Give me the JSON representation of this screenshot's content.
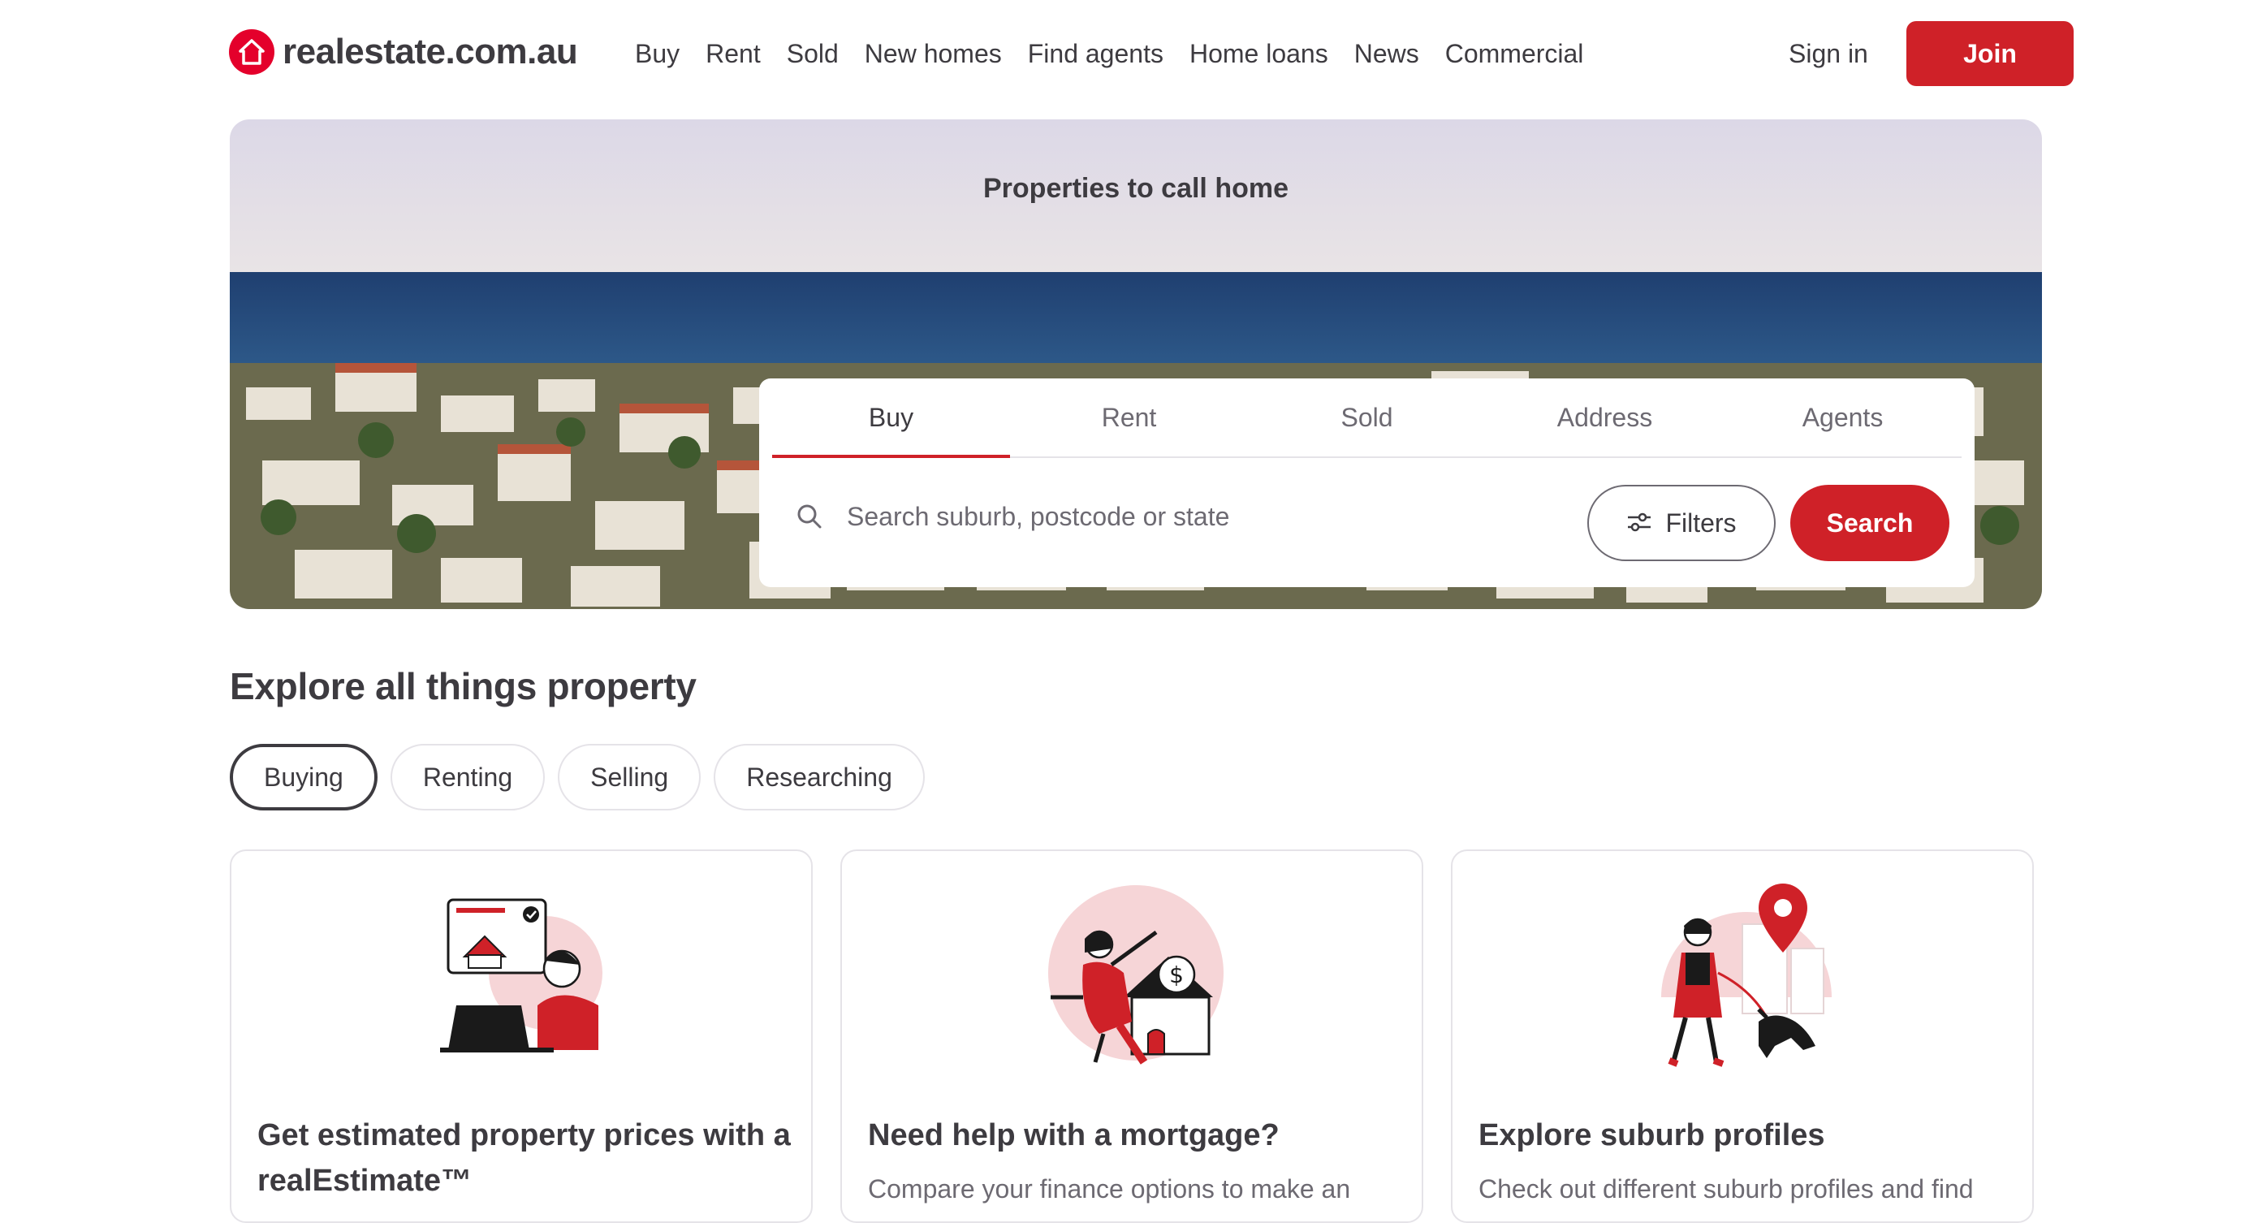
{
  "header": {
    "logo_text": "realestate.com.au",
    "nav": [
      "Buy",
      "Rent",
      "Sold",
      "New homes",
      "Find agents",
      "Home loans",
      "News",
      "Commercial"
    ],
    "signin_label": "Sign in",
    "join_label": "Join"
  },
  "hero": {
    "title": "Properties to call home",
    "tabs": [
      "Buy",
      "Rent",
      "Sold",
      "Address",
      "Agents"
    ],
    "active_tab": "Buy",
    "search_placeholder": "Search suburb, postcode or state",
    "filters_label": "Filters",
    "search_label": "Search"
  },
  "explore": {
    "title": "Explore all things property",
    "chips": [
      "Buying",
      "Renting",
      "Selling",
      "Researching"
    ],
    "active_chip": "Buying",
    "cards": [
      {
        "title": "Get estimated property prices with a realEstimate™",
        "desc": ""
      },
      {
        "title": "Need help with a mortgage?",
        "desc": "Compare your finance options to make an"
      },
      {
        "title": "Explore suburb profiles",
        "desc": "Check out different suburb profiles and find"
      }
    ]
  },
  "colors": {
    "brand_red": "#cf2128",
    "text": "#3d3b40",
    "muted": "#6d6a72"
  },
  "icons": [
    "house-logo-icon",
    "search-icon",
    "filters-sliders-icon",
    "price-estimate-illustration",
    "mortgage-illustration",
    "suburb-profile-illustration"
  ]
}
